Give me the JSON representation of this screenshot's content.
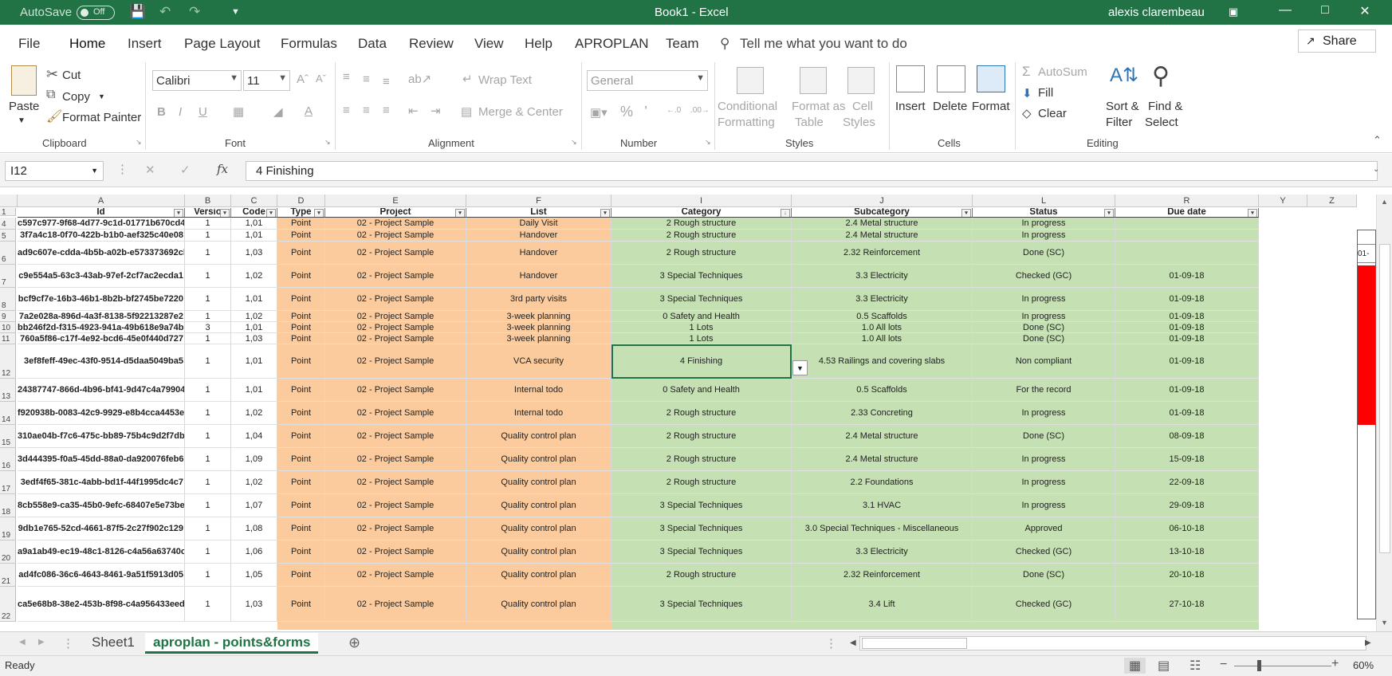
{
  "titlebar": {
    "autosave_label": "AutoSave",
    "autosave_state": "Off",
    "title": "Book1  -  Excel",
    "user": "alexis clarembeau"
  },
  "menu": {
    "tabs": [
      "File",
      "Home",
      "Insert",
      "Page Layout",
      "Formulas",
      "Data",
      "Review",
      "View",
      "Help",
      "APROPLAN",
      "Team"
    ],
    "tell_me": "Tell me what you want to do",
    "share": "Share"
  },
  "ribbon": {
    "clipboard": {
      "paste": "Paste",
      "cut": "Cut",
      "copy": "Copy",
      "format_painter": "Format Painter",
      "label": "Clipboard"
    },
    "font": {
      "name": "Calibri",
      "size": "11",
      "label": "Font"
    },
    "alignment": {
      "wrap": "Wrap Text",
      "merge": "Merge & Center",
      "label": "Alignment"
    },
    "number": {
      "format": "General",
      "label": "Number"
    },
    "styles": {
      "cond1": "Conditional",
      "cond2": "Formatting",
      "table1": "Format as",
      "table2": "Table",
      "cell1": "Cell",
      "cell2": "Styles",
      "label": "Styles"
    },
    "cells": {
      "insert": "Insert",
      "delete": "Delete",
      "format": "Format",
      "label": "Cells"
    },
    "editing": {
      "autosum": "AutoSum",
      "fill": "Fill",
      "clear": "Clear",
      "sort1": "Sort &",
      "sort2": "Filter",
      "find1": "Find &",
      "find2": "Select",
      "label": "Editing"
    }
  },
  "formula": {
    "namebox": "I12",
    "fx": "fx",
    "value": "4 Finishing"
  },
  "columns": [
    "A",
    "B",
    "C",
    "D",
    "E",
    "F",
    "I",
    "J",
    "L",
    "R",
    "Y",
    "Z"
  ],
  "headers": [
    "Id",
    "Versio",
    "Code",
    "Type",
    "Project",
    "List",
    "Category",
    "Subcategory",
    "Status",
    "Due date"
  ],
  "rows": [
    {
      "n": "1"
    },
    {
      "n": "4",
      "id": "c597c977-9f68-4d77-9c1d-01771b670cd4",
      "v": "1",
      "code": "1,01",
      "type": "Point",
      "project": "02 - Project Sample",
      "list": "Daily Visit",
      "cat": "2 Rough structure",
      "sub": "2.4 Metal structure",
      "status": "In progress",
      "due": ""
    },
    {
      "n": "5",
      "id": "3f7a4c18-0f70-422b-b1b0-aef325c40e08",
      "v": "1",
      "code": "1,01",
      "type": "Point",
      "project": "02 - Project Sample",
      "list": "Handover",
      "cat": "2 Rough structure",
      "sub": "2.4 Metal structure",
      "status": "In progress",
      "due": ""
    },
    {
      "n": "6",
      "id": "ad9c607e-cdda-4b5b-a02b-e573373692cb",
      "v": "1",
      "code": "1,03",
      "type": "Point",
      "project": "02 - Project Sample",
      "list": "Handover",
      "cat": "2 Rough structure",
      "sub": "2.32 Reinforcement",
      "status": "Done (SC)",
      "due": ""
    },
    {
      "n": "7",
      "id": "c9e554a5-63c3-43ab-97ef-2cf7ac2ecda1",
      "v": "1",
      "code": "1,02",
      "type": "Point",
      "project": "02 - Project Sample",
      "list": "Handover",
      "cat": "3 Special Techniques",
      "sub": "3.3 Electricity",
      "status": "Checked (GC)",
      "due": "01-09-18"
    },
    {
      "n": "8",
      "id": "bcf9cf7e-16b3-46b1-8b2b-bf2745be7220",
      "v": "1",
      "code": "1,01",
      "type": "Point",
      "project": "02 - Project Sample",
      "list": "3rd party visits",
      "cat": "3 Special Techniques",
      "sub": "3.3 Electricity",
      "status": "In progress",
      "due": "01-09-18"
    },
    {
      "n": "9",
      "id": "7a2e028a-896d-4a3f-8138-5f92213287e2",
      "v": "1",
      "code": "1,02",
      "type": "Point",
      "project": "02 - Project Sample",
      "list": "3-week planning",
      "cat": "0 Safety and Health",
      "sub": "0.5 Scaffolds",
      "status": "In progress",
      "due": "01-09-18"
    },
    {
      "n": "10",
      "id": "bb246f2d-f315-4923-941a-49b618e9a74b",
      "v": "3",
      "code": "1,01",
      "type": "Point",
      "project": "02 - Project Sample",
      "list": "3-week planning",
      "cat": "1 Lots",
      "sub": "1.0 All lots",
      "status": "Done (SC)",
      "due": "01-09-18"
    },
    {
      "n": "11",
      "id": "760a5f86-c17f-4e92-bcd6-45e0f440d727",
      "v": "1",
      "code": "1,03",
      "type": "Point",
      "project": "02 - Project Sample",
      "list": "3-week planning",
      "cat": "1 Lots",
      "sub": "1.0 All lots",
      "status": "Done (SC)",
      "due": "01-09-18"
    },
    {
      "n": "12",
      "id": "3ef8feff-49ec-43f0-9514-d5daa5049ba5",
      "v": "1",
      "code": "1,01",
      "type": "Point",
      "project": "02 - Project Sample",
      "list": "VCA security",
      "cat": "4 Finishing",
      "sub": "4.53 Railings and covering slabs",
      "status": "Non compliant",
      "due": "01-09-18"
    },
    {
      "n": "13",
      "id": "24387747-866d-4b96-bf41-9d47c4a79904",
      "v": "1",
      "code": "1,01",
      "type": "Point",
      "project": "02 - Project Sample",
      "list": "Internal todo",
      "cat": "0 Safety and Health",
      "sub": "0.5 Scaffolds",
      "status": "For the record",
      "due": "01-09-18"
    },
    {
      "n": "14",
      "id": "f920938b-0083-42c9-9929-e8b4cca4453e",
      "v": "1",
      "code": "1,02",
      "type": "Point",
      "project": "02 - Project Sample",
      "list": "Internal todo",
      "cat": "2 Rough structure",
      "sub": "2.33 Concreting",
      "status": "In progress",
      "due": "01-09-18"
    },
    {
      "n": "15",
      "id": "310ae04b-f7c6-475c-bb89-75b4c9d2f7db",
      "v": "1",
      "code": "1,04",
      "type": "Point",
      "project": "02 - Project Sample",
      "list": "Quality control plan",
      "cat": "2 Rough structure",
      "sub": "2.4 Metal structure",
      "status": "Done (SC)",
      "due": "08-09-18"
    },
    {
      "n": "16",
      "id": "3d444395-f0a5-45dd-88a0-da920076feb6",
      "v": "1",
      "code": "1,09",
      "type": "Point",
      "project": "02 - Project Sample",
      "list": "Quality control plan",
      "cat": "2 Rough structure",
      "sub": "2.4 Metal structure",
      "status": "In progress",
      "due": "15-09-18"
    },
    {
      "n": "17",
      "id": "3edf4f65-381c-4abb-bd1f-44f1995dc4c7",
      "v": "1",
      "code": "1,02",
      "type": "Point",
      "project": "02 - Project Sample",
      "list": "Quality control plan",
      "cat": "2 Rough structure",
      "sub": "2.2 Foundations",
      "status": "In progress",
      "due": "22-09-18"
    },
    {
      "n": "18",
      "id": "8cb558e9-ca35-45b0-9efc-68407e5e73be",
      "v": "1",
      "code": "1,07",
      "type": "Point",
      "project": "02 - Project Sample",
      "list": "Quality control plan",
      "cat": "3 Special Techniques",
      "sub": "3.1 HVAC",
      "status": "In progress",
      "due": "29-09-18"
    },
    {
      "n": "19",
      "id": "9db1e765-52cd-4661-87f5-2c27f902c129",
      "v": "1",
      "code": "1,08",
      "type": "Point",
      "project": "02 - Project Sample",
      "list": "Quality control plan",
      "cat": "3 Special Techniques",
      "sub": "3.0 Special Techniques - Miscellaneous",
      "status": "Approved",
      "due": "06-10-18"
    },
    {
      "n": "20",
      "id": "a9a1ab49-ec19-48c1-8126-c4a56a63740c",
      "v": "1",
      "code": "1,06",
      "type": "Point",
      "project": "02 - Project Sample",
      "list": "Quality control plan",
      "cat": "3 Special Techniques",
      "sub": "3.3 Electricity",
      "status": "Checked (GC)",
      "due": "13-10-18"
    },
    {
      "n": "21",
      "id": "ad4fc086-36c6-4643-8461-9a51f5913d05",
      "v": "1",
      "code": "1,05",
      "type": "Point",
      "project": "02 - Project Sample",
      "list": "Quality control plan",
      "cat": "2 Rough structure",
      "sub": "2.32 Reinforcement",
      "status": "Done (SC)",
      "due": "20-10-18"
    },
    {
      "n": "22",
      "id": "ca5e68b8-38e2-453b-8f98-c4a956433eed",
      "v": "1",
      "code": "1,03",
      "type": "Point",
      "project": "02 - Project Sample",
      "list": "Quality control plan",
      "cat": "3 Special Techniques",
      "sub": "3.4 Lift",
      "status": "Checked (GC)",
      "due": "27-10-18"
    }
  ],
  "side_cell": "01-",
  "sheets": [
    "Sheet1",
    "aproplan - points&forms"
  ],
  "status": {
    "ready": "Ready",
    "zoom": "60%"
  },
  "colors": {
    "accent": "#217346",
    "orange": "#fbcb9d",
    "green": "#c5e0b3",
    "red": "#ff0000"
  }
}
